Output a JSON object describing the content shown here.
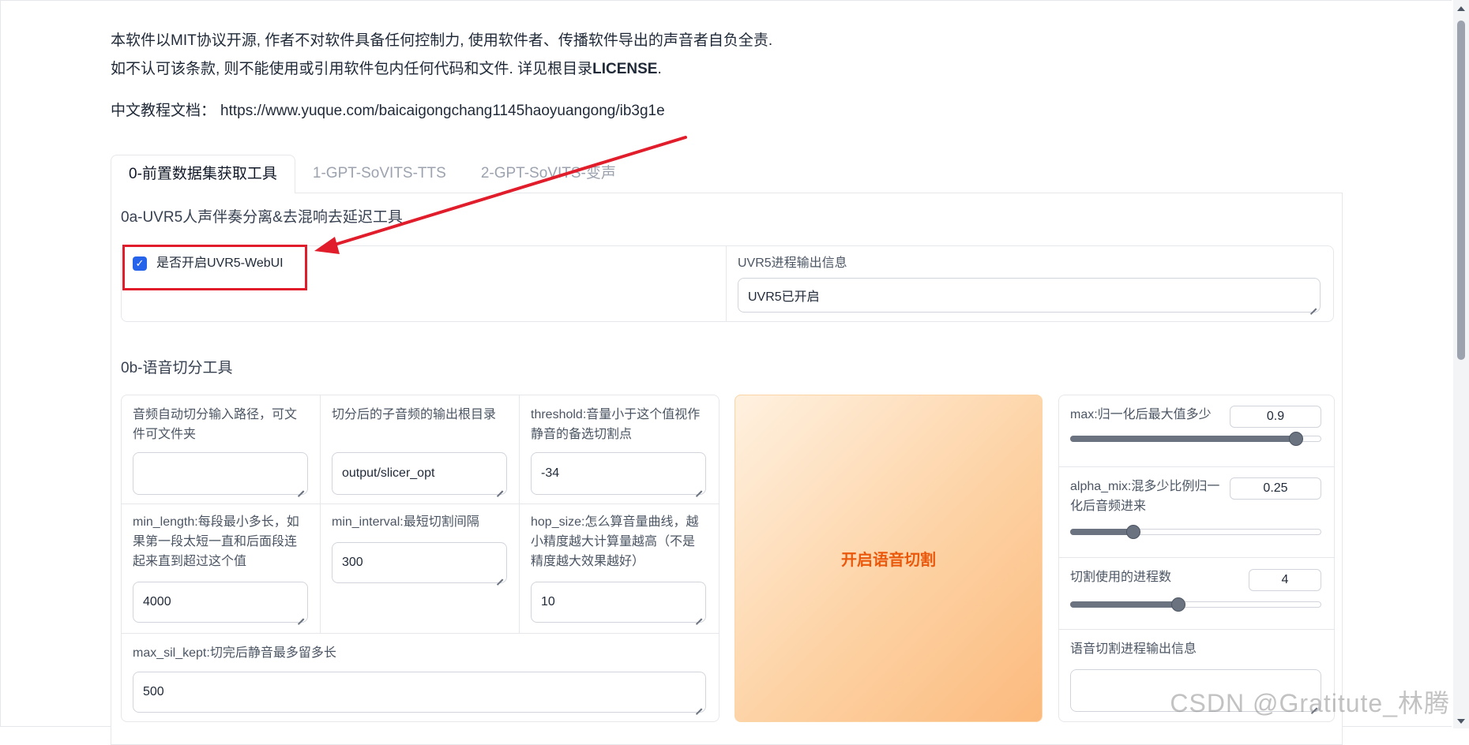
{
  "header": {
    "disclaimer_line1": "本软件以MIT协议开源, 作者不对软件具备任何控制力, 使用软件者、传播软件导出的声音者自负全责.",
    "disclaimer_line2_prefix": "如不认可该条款, 则不能使用或引用软件包内任何代码和文件. 详见根目录",
    "disclaimer_line2_bold": "LICENSE",
    "disclaimer_line2_suffix": ".",
    "doc_label": "中文教程文档：",
    "doc_url": "https://www.yuque.com/baicaigongchang1145haoyuangong/ib3g1e"
  },
  "tabs": [
    {
      "label": "0-前置数据集获取工具",
      "active": true
    },
    {
      "label": "1-GPT-SoVITS-TTS",
      "active": false
    },
    {
      "label": "2-GPT-SoVITS-变声",
      "active": false
    }
  ],
  "uvr5": {
    "section_title": "0a-UVR5人声伴奏分离&去混响去延迟工具",
    "checkbox_label": "是否开启UVR5-WebUI",
    "checkbox_checked": true,
    "output_label": "UVR5进程输出信息",
    "output_value": "UVR5已开启"
  },
  "slicer": {
    "section_title": "0b-语音切分工具",
    "input_path_label": "音频自动切分输入路径，可文件可文件夹",
    "input_path_value": "",
    "output_root_label": "切分后的子音频的输出根目录",
    "output_root_value": "output/slicer_opt",
    "threshold_label": "threshold:音量小于这个值视作静音的备选切割点",
    "threshold_value": "-34",
    "min_length_label": "min_length:每段最小多长，如果第一段太短一直和后面段连起来直到超过这个值",
    "min_length_value": "4000",
    "min_interval_label": "min_interval:最短切割间隔",
    "min_interval_value": "300",
    "hop_size_label": "hop_size:怎么算音量曲线，越小精度越大计算量越高（不是精度越大效果越好）",
    "hop_size_value": "10",
    "max_sil_kept_label": "max_sil_kept:切完后静音最多留多长",
    "max_sil_kept_value": "500",
    "start_button_label": "开启语音切割",
    "max_label": "max:归一化后最大值多少",
    "max_value": "0.9",
    "max_fraction": 0.9,
    "alpha_mix_label": "alpha_mix:混多少比例归一化后音频进来",
    "alpha_mix_value": "0.25",
    "alpha_mix_fraction": 0.25,
    "process_count_label": "切割使用的进程数",
    "process_count_value": "4",
    "process_count_fraction": 0.43,
    "progress_output_label": "语音切割进程输出信息",
    "progress_output_value": ""
  },
  "watermark": "CSDN @Gratitute_林腾",
  "colors": {
    "accent_checkbox": "#2563eb",
    "primary_button_text": "#ea580c",
    "annotation_red": "#e11d2b"
  }
}
